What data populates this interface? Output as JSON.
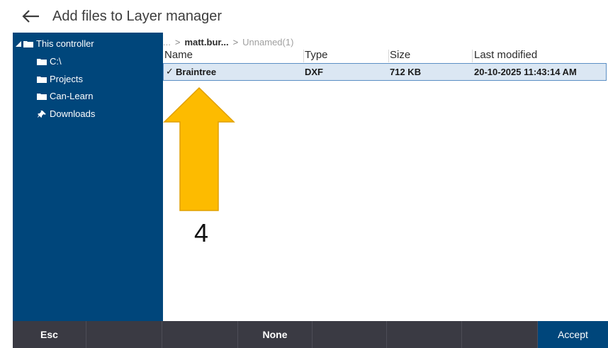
{
  "header": {
    "title": "Add files to Layer manager",
    "back_icon": "back-arrow-icon"
  },
  "sidebar": {
    "items": [
      {
        "label": "This controller",
        "icon": "folder-icon",
        "expanded": true
      },
      {
        "label": "C:\\",
        "icon": "folder-icon"
      },
      {
        "label": "Projects",
        "icon": "folder-icon"
      },
      {
        "label": "Can-Learn",
        "icon": "folder-icon"
      },
      {
        "label": "Downloads",
        "icon": "pin-icon"
      }
    ]
  },
  "breadcrumb": {
    "ellipsis": "...",
    "parent": "matt.bur...",
    "current": "Unnamed(1)",
    "separator": ">"
  },
  "table": {
    "columns": [
      "Name",
      "Type",
      "Size",
      "Last modified"
    ],
    "rows": [
      {
        "selected": true,
        "name": "Braintree",
        "type": "DXF",
        "size": "712 KB",
        "modified": "20-10-2025 11:43:14 AM"
      }
    ]
  },
  "annotation": {
    "number": "4",
    "color": "#fdbb00"
  },
  "bottom_bar": {
    "buttons": [
      "Esc",
      "",
      "",
      "None",
      "",
      "",
      "",
      "Accept"
    ]
  },
  "colors": {
    "sidebar": "#00467b",
    "bottom_bar": "#3a3a43",
    "selection": "#dbe7f3",
    "accent": "#00467b"
  }
}
